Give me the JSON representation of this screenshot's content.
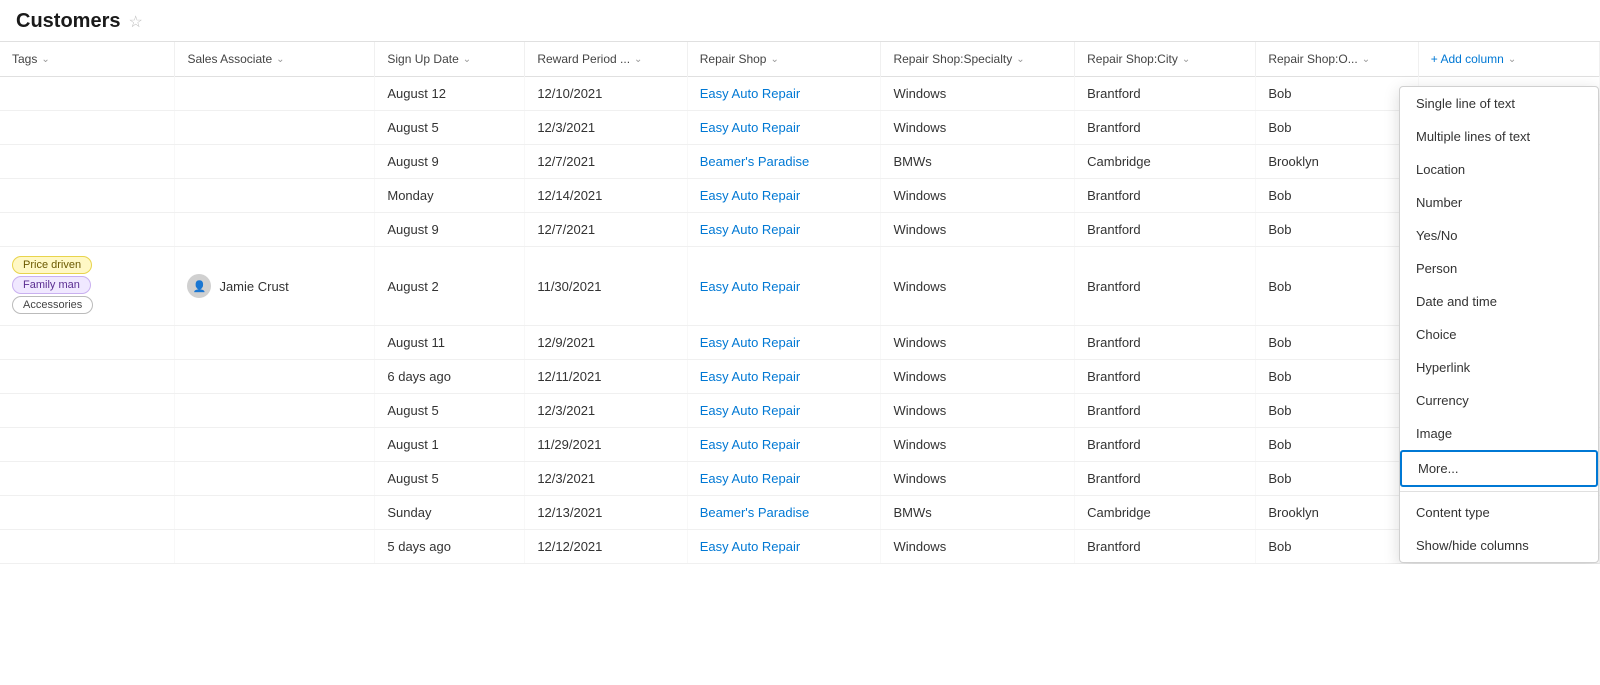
{
  "header": {
    "title": "Customers",
    "star_label": "☆"
  },
  "columns": [
    {
      "id": "tags",
      "label": "Tags",
      "has_chevron": true
    },
    {
      "id": "sales_associate",
      "label": "Sales Associate",
      "has_chevron": true
    },
    {
      "id": "sign_up_date",
      "label": "Sign Up Date",
      "has_chevron": true
    },
    {
      "id": "reward_period",
      "label": "Reward Period ...",
      "has_chevron": true
    },
    {
      "id": "repair_shop",
      "label": "Repair Shop",
      "has_chevron": true
    },
    {
      "id": "repair_shop_specialty",
      "label": "Repair Shop:Specialty",
      "has_chevron": true
    },
    {
      "id": "repair_shop_city",
      "label": "Repair Shop:City",
      "has_chevron": true
    },
    {
      "id": "repair_shop_o",
      "label": "Repair Shop:O...",
      "has_chevron": true
    },
    {
      "id": "add_column",
      "label": "+ Add column",
      "has_chevron": true
    }
  ],
  "rows": [
    {
      "tags": "",
      "sales_associate": "",
      "sign_up_date": "August 12",
      "reward_period": "12/10/2021",
      "repair_shop": "Easy Auto Repair",
      "repair_shop_specialty": "Windows",
      "repair_shop_city": "Brantford",
      "repair_shop_o": "Bob"
    },
    {
      "tags": "",
      "sales_associate": "",
      "sign_up_date": "August 5",
      "reward_period": "12/3/2021",
      "repair_shop": "Easy Auto Repair",
      "repair_shop_specialty": "Windows",
      "repair_shop_city": "Brantford",
      "repair_shop_o": "Bob"
    },
    {
      "tags": "",
      "sales_associate": "",
      "sign_up_date": "August 9",
      "reward_period": "12/7/2021",
      "repair_shop": "Beamer's Paradise",
      "repair_shop_specialty": "BMWs",
      "repair_shop_city": "Cambridge",
      "repair_shop_o": "Brooklyn"
    },
    {
      "tags": "",
      "sales_associate": "",
      "sign_up_date": "Monday",
      "reward_period": "12/14/2021",
      "repair_shop": "Easy Auto Repair",
      "repair_shop_specialty": "Windows",
      "repair_shop_city": "Brantford",
      "repair_shop_o": "Bob"
    },
    {
      "tags": "",
      "sales_associate": "",
      "sign_up_date": "August 9",
      "reward_period": "12/7/2021",
      "repair_shop": "Easy Auto Repair",
      "repair_shop_specialty": "Windows",
      "repair_shop_city": "Brantford",
      "repair_shop_o": "Bob"
    },
    {
      "tags": "tags_special",
      "sales_associate": "Jamie Crust",
      "sign_up_date": "August 2",
      "reward_period": "11/30/2021",
      "repair_shop": "Easy Auto Repair",
      "repair_shop_specialty": "Windows",
      "repair_shop_city": "Brantford",
      "repair_shop_o": "Bob"
    },
    {
      "tags": "",
      "sales_associate": "",
      "sign_up_date": "August 11",
      "reward_period": "12/9/2021",
      "repair_shop": "Easy Auto Repair",
      "repair_shop_specialty": "Windows",
      "repair_shop_city": "Brantford",
      "repair_shop_o": "Bob"
    },
    {
      "tags": "",
      "sales_associate": "",
      "sign_up_date": "6 days ago",
      "reward_period": "12/11/2021",
      "repair_shop": "Easy Auto Repair",
      "repair_shop_specialty": "Windows",
      "repair_shop_city": "Brantford",
      "repair_shop_o": "Bob"
    },
    {
      "tags": "",
      "sales_associate": "",
      "sign_up_date": "August 5",
      "reward_period": "12/3/2021",
      "repair_shop": "Easy Auto Repair",
      "repair_shop_specialty": "Windows",
      "repair_shop_city": "Brantford",
      "repair_shop_o": "Bob"
    },
    {
      "tags": "",
      "sales_associate": "",
      "sign_up_date": "August 1",
      "reward_period": "11/29/2021",
      "repair_shop": "Easy Auto Repair",
      "repair_shop_specialty": "Windows",
      "repair_shop_city": "Brantford",
      "repair_shop_o": "Bob"
    },
    {
      "tags": "",
      "sales_associate": "",
      "sign_up_date": "August 5",
      "reward_period": "12/3/2021",
      "repair_shop": "Easy Auto Repair",
      "repair_shop_specialty": "Windows",
      "repair_shop_city": "Brantford",
      "repair_shop_o": "Bob"
    },
    {
      "tags": "",
      "sales_associate": "",
      "sign_up_date": "Sunday",
      "reward_period": "12/13/2021",
      "repair_shop": "Beamer's Paradise",
      "repair_shop_specialty": "BMWs",
      "repair_shop_city": "Cambridge",
      "repair_shop_o": "Brooklyn"
    },
    {
      "tags": "",
      "sales_associate": "",
      "sign_up_date": "5 days ago",
      "reward_period": "12/12/2021",
      "repair_shop": "Easy Auto Repair",
      "repair_shop_specialty": "Windows",
      "repair_shop_city": "Brantford",
      "repair_shop_o": "Bob"
    }
  ],
  "dropdown": {
    "items": [
      {
        "label": "Single line of text",
        "type": "normal"
      },
      {
        "label": "Multiple lines of text",
        "type": "normal"
      },
      {
        "label": "Location",
        "type": "normal"
      },
      {
        "label": "Number",
        "type": "normal"
      },
      {
        "label": "Yes/No",
        "type": "normal"
      },
      {
        "label": "Person",
        "type": "normal"
      },
      {
        "label": "Date and time",
        "type": "normal"
      },
      {
        "label": "Choice",
        "type": "normal"
      },
      {
        "label": "Hyperlink",
        "type": "normal"
      },
      {
        "label": "Currency",
        "type": "normal"
      },
      {
        "label": "Image",
        "type": "normal"
      },
      {
        "label": "More...",
        "type": "highlighted"
      },
      {
        "label": "Content type",
        "type": "separator-before"
      },
      {
        "label": "Show/hide columns",
        "type": "normal"
      }
    ]
  }
}
